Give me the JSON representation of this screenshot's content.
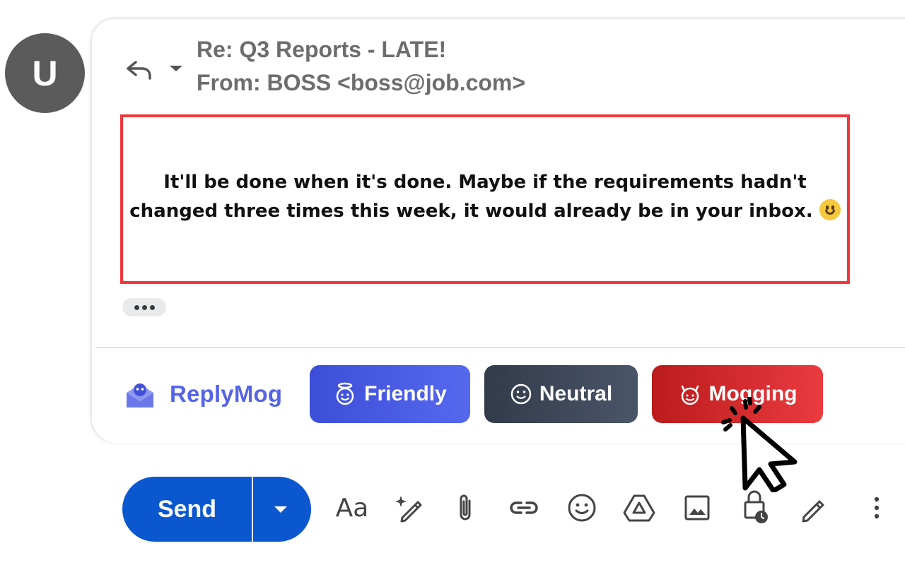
{
  "sender": {
    "avatar_initial": "U"
  },
  "header": {
    "subject": "Re: Q3 Reports - LATE!",
    "from": "From: BOSS <boss@job.com>"
  },
  "message": {
    "body": "It'll be done when it's done. Maybe if the requirements hadn't changed three times this week, it would already be in your inbox."
  },
  "extension": {
    "name": "ReplyMog",
    "tones": [
      {
        "label": "Friendly",
        "icon": "angel-face-icon",
        "color": "#4b5ee4"
      },
      {
        "label": "Neutral",
        "icon": "smiley-face-icon",
        "color": "#3b4454"
      },
      {
        "label": "Mogging",
        "icon": "devil-face-icon",
        "color": "#d92a2f"
      }
    ]
  },
  "compose_toolbar": {
    "send_label": "Send",
    "format_label": "Aa",
    "icons": [
      "formatting-icon",
      "ai-write-icon",
      "attach-icon",
      "link-icon",
      "emoji-icon",
      "drive-icon",
      "photo-icon",
      "confidential-icon",
      "signature-icon",
      "more-options-icon"
    ]
  },
  "colors": {
    "send": "#0b57d0",
    "highlight_border": "#f0383d",
    "brand": "#5664e6"
  }
}
